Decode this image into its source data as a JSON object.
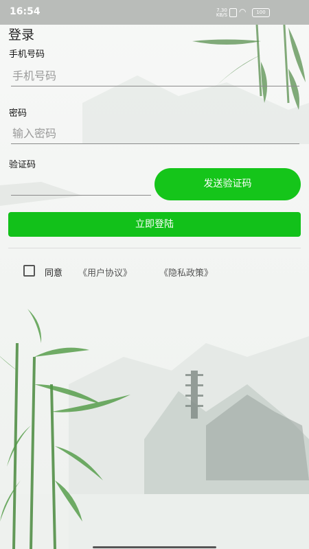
{
  "status": {
    "time": "16:54",
    "speed": "7.30 KB/S",
    "battery": "100"
  },
  "page": {
    "title": "登录"
  },
  "phone": {
    "label": "手机号码",
    "placeholder": "手机号码"
  },
  "password": {
    "label": "密码",
    "placeholder": "输入密码"
  },
  "code": {
    "label": "验证码",
    "send_label": "发送验证码"
  },
  "login": {
    "label": "立即登陆"
  },
  "agreement": {
    "agree_label": "同意",
    "user_link": "《用户协议》",
    "privacy_link": "《隐私政策》"
  },
  "colors": {
    "accent": "#15c51a",
    "statusbar": "#b9bcb9"
  }
}
